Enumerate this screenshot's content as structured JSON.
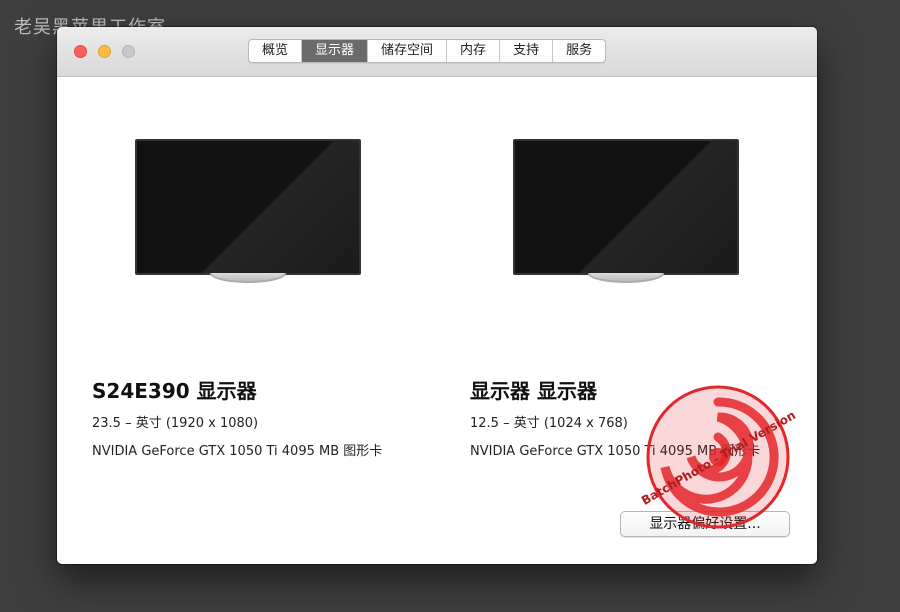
{
  "watermark_top": "老吴黑苹果工作室",
  "tabs": [
    "概览",
    "显示器",
    "储存空间",
    "内存",
    "支持",
    "服务"
  ],
  "active_tab": "显示器",
  "displays": [
    {
      "name": "S24E390 显示器",
      "size": "23.5 – 英寸 (1920 x 1080)",
      "gpu": "NVIDIA GeForce GTX 1050 Ti 4095 MB 图形卡"
    },
    {
      "name": "显示器 显示器",
      "size": "12.5 – 英寸 (1024 x 768)",
      "gpu": "NVIDIA GeForce GTX 1050 Ti 4095 MB 图形卡"
    }
  ],
  "prefs_button": "显示器偏好设置...",
  "batch_watermark": "BatchPhoto - Trial Version",
  "colors": {
    "active_tab": "#6b6b6b",
    "close": "#fc605c",
    "minimize": "#fdbc40",
    "zoom": "#c9c9c9",
    "watermark_red": "#e3262a"
  }
}
